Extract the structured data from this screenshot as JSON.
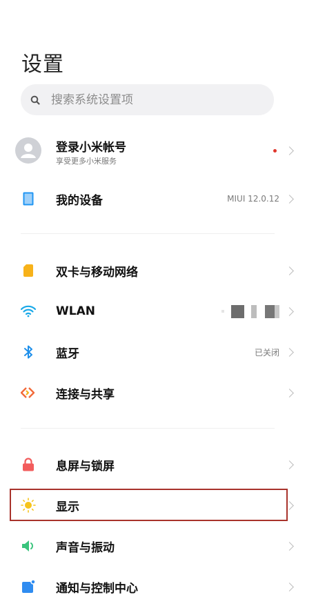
{
  "page": {
    "title": "设置"
  },
  "search": {
    "placeholder": "搜索系统设置项"
  },
  "account": {
    "label": "登录小米帐号",
    "subtitle": "享受更多小米服务"
  },
  "device": {
    "label": "我的设备",
    "value": "MIUI 12.0.12"
  },
  "network": [
    {
      "label": "双卡与移动网络",
      "icon": "sim-card-icon",
      "color": "#f7b21a"
    },
    {
      "label": "WLAN",
      "icon": "wifi-icon",
      "color": "#1aa9e8"
    },
    {
      "label": "蓝牙",
      "icon": "bluetooth-icon",
      "color": "#1e8fea",
      "value": "已关闭"
    },
    {
      "label": "连接与共享",
      "icon": "share-icon",
      "color": "#f26a3a"
    }
  ],
  "system": [
    {
      "label": "息屏与锁屏",
      "icon": "lock-icon",
      "color": "#f25c5c"
    },
    {
      "label": "显示",
      "icon": "sun-icon",
      "color": "#f6c41d",
      "highlighted": true
    },
    {
      "label": "声音与振动",
      "icon": "speaker-icon",
      "color": "#3ac47d"
    },
    {
      "label": "通知与控制中心",
      "icon": "notification-icon",
      "color": "#2f8cf0"
    }
  ],
  "colors": {
    "highlight_border": "#a8322b",
    "notification_dot": "#e0362c"
  }
}
